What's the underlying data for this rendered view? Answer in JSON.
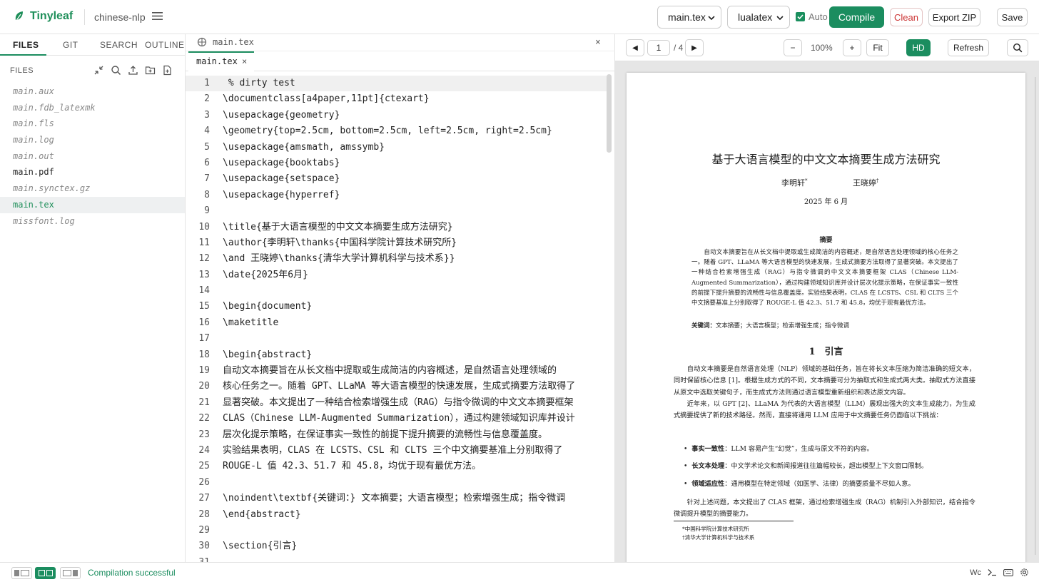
{
  "app": {
    "name": "Tinyleaf",
    "project": "chinese-nlp",
    "accent": "#1b8d5f"
  },
  "toolbar": {
    "file_select": "main.tex",
    "engine_select": "lualatex",
    "auto_label": "Auto",
    "auto_checked": true,
    "compile_label": "Compile",
    "clean_label": "Clean",
    "export_label": "Export ZIP",
    "save_label": "Save"
  },
  "sidebar": {
    "tabs": [
      "FILES",
      "GIT",
      "SEARCH",
      "OUTLINE"
    ],
    "active_tab": "FILES",
    "files_header": "FILES",
    "files": [
      {
        "name": "main.aux",
        "style": "generated"
      },
      {
        "name": "main.fdb_latexmk",
        "style": "generated"
      },
      {
        "name": "main.fls",
        "style": "generated"
      },
      {
        "name": "main.log",
        "style": "generated"
      },
      {
        "name": "main.out",
        "style": "generated"
      },
      {
        "name": "main.pdf",
        "style": "normal"
      },
      {
        "name": "main.synctex.gz",
        "style": "generated"
      },
      {
        "name": "main.tex",
        "style": "active"
      },
      {
        "name": "missfont.log",
        "style": "generated"
      }
    ]
  },
  "editor": {
    "breadcrumb": "main.tex",
    "open_tab": "main.tex",
    "close_glyph": "×",
    "lines": [
      {
        "n": "1",
        "t": " % dirty test"
      },
      {
        "n": "2",
        "t": "\\documentclass[a4paper,11pt]{ctexart}"
      },
      {
        "n": "3",
        "t": "\\usepackage{geometry}"
      },
      {
        "n": "4",
        "t": "\\geometry{top=2.5cm, bottom=2.5cm, left=2.5cm, right=2.5cm}"
      },
      {
        "n": "5",
        "t": "\\usepackage{amsmath, amssymb}"
      },
      {
        "n": "6",
        "t": "\\usepackage{booktabs}"
      },
      {
        "n": "7",
        "t": "\\usepackage{setspace}"
      },
      {
        "n": "8",
        "t": "\\usepackage{hyperref}"
      },
      {
        "n": "9",
        "t": ""
      },
      {
        "n": "10",
        "t": "\\title{基于大语言模型的中文文本摘要生成方法研究}"
      },
      {
        "n": "11",
        "t": "\\author{李明轩\\thanks{中国科学院计算技术研究所}"
      },
      {
        "n": "12",
        "t": "\\and 王晓婷\\thanks{清华大学计算机科学与技术系}}"
      },
      {
        "n": "13",
        "t": "\\date{2025年6月}"
      },
      {
        "n": "14",
        "t": ""
      },
      {
        "n": "15",
        "t": "\\begin{document}"
      },
      {
        "n": "16",
        "t": "\\maketitle"
      },
      {
        "n": "17",
        "t": ""
      },
      {
        "n": "18",
        "t": "\\begin{abstract}"
      },
      {
        "n": "19",
        "t": "自动文本摘要旨在从长文档中提取或生成简洁的内容概述，是自然语言处理领域的"
      },
      {
        "n": "20",
        "t": "核心任务之一。随着 GPT、LLaMA 等大语言模型的快速发展，生成式摘要方法取得了"
      },
      {
        "n": "21",
        "t": "显著突破。本文提出了一种结合检索增强生成（RAG）与指令微调的中文文本摘要框架"
      },
      {
        "n": "22",
        "t": "CLAS（Chinese LLM-Augmented Summarization），通过构建领域知识库并设计"
      },
      {
        "n": "23",
        "t": "层次化提示策略，在保证事实一致性的前提下提升摘要的流畅性与信息覆盖度。"
      },
      {
        "n": "24",
        "t": "实验结果表明，CLAS 在 LCSTS、CSL 和 CLTS 三个中文摘要基准上分别取得了"
      },
      {
        "n": "25",
        "t": "ROUGE-L 值 42.3、51.7 和 45.8，均优于现有最优方法。"
      },
      {
        "n": "26",
        "t": ""
      },
      {
        "n": "27",
        "t": "\\noindent\\textbf{关键词：} 文本摘要；大语言模型；检索增强生成；指令微调"
      },
      {
        "n": "28",
        "t": "\\end{abstract}"
      },
      {
        "n": "29",
        "t": ""
      },
      {
        "n": "30",
        "t": "\\section{引言}"
      },
      {
        "n": "31",
        "t": ""
      }
    ]
  },
  "pdf_toolbar": {
    "prev": "◀",
    "next": "▶",
    "page": "1",
    "total": "/ 4",
    "zoom_out": "−",
    "zoom": "100%",
    "zoom_in": "+",
    "fit": "Fit",
    "hd": "HD",
    "refresh": "Refresh"
  },
  "pdf": {
    "title": "基于大语言模型的中文文本摘要生成方法研究",
    "author1": "李明轩",
    "author1_mark": "*",
    "author2": "王晓婷",
    "author2_mark": "†",
    "date": "2025 年 6 月",
    "abstract_heading": "摘要",
    "abstract": "　　自动文本摘要旨在从长文档中提取或生成简洁的内容概述，是自然语言处理领域的核心任务之一。随着 GPT、LLaMA 等大语言模型的快速发展，生成式摘要方法取得了显著突破。本文提出了一种结合检索增强生成（RAG）与指令微调的中文文本摘要框架 CLAS（Chinese LLM-Augmented Summarization），通过构建领域知识库并设计层次化提示策略，在保证事实一致性的前提下提升摘要的流畅性与信息覆盖度。实验结果表明，CLAS 在 LCSTS、CSL 和 CLTS 三个中文摘要基准上分别取得了 ROUGE-L 值 42.3、51.7 和 45.8，均优于现有最优方法。",
    "keywords_label": "关键词：",
    "keywords": "文本摘要；大语言模型；检索增强生成；指令微调",
    "section_title": "1　引言",
    "para1": "　　自动文本摘要是自然语言处理（NLP）领域的基础任务，旨在将长文本压缩为简洁准确的短文本，同时保留核心信息 [1]。根据生成方式的不同，文本摘要可分为抽取式和生成式两大类。抽取式方法直接从原文中选取关键句子，而生成式方法则通过语言模型重新组织和表达原文内容。",
    "para2": "　　近年来，以 GPT [2]、LLaMA 为代表的大语言模型（LLM）展现出强大的文本生成能力，为生成式摘要提供了新的技术路径。然而，直接将通用 LLM 应用于中文摘要任务仍面临以下挑战：",
    "bullets": [
      {
        "label": "事实一致性",
        "text": "：LLM 容易产生“幻觉”，生成与原文不符的内容。"
      },
      {
        "label": "长文本处理",
        "text": "：中文学术论文和新闻报道往往篇幅较长，超出模型上下文窗口限制。"
      },
      {
        "label": "领域适应性",
        "text": "：通用模型在特定领域（如医学、法律）的摘要质量不尽如人意。"
      }
    ],
    "para3": "　　针对上述问题，本文提出了 CLAS 框架，通过检索增强生成（RAG）机制引入外部知识，结合指令微调提升模型的摘要能力。",
    "footnote1": "*中国科学院计算技术研究所",
    "footnote2": "†清华大学计算机科学与技术系"
  },
  "status": {
    "message": "Compilation successful",
    "wc_label": "Wc"
  }
}
